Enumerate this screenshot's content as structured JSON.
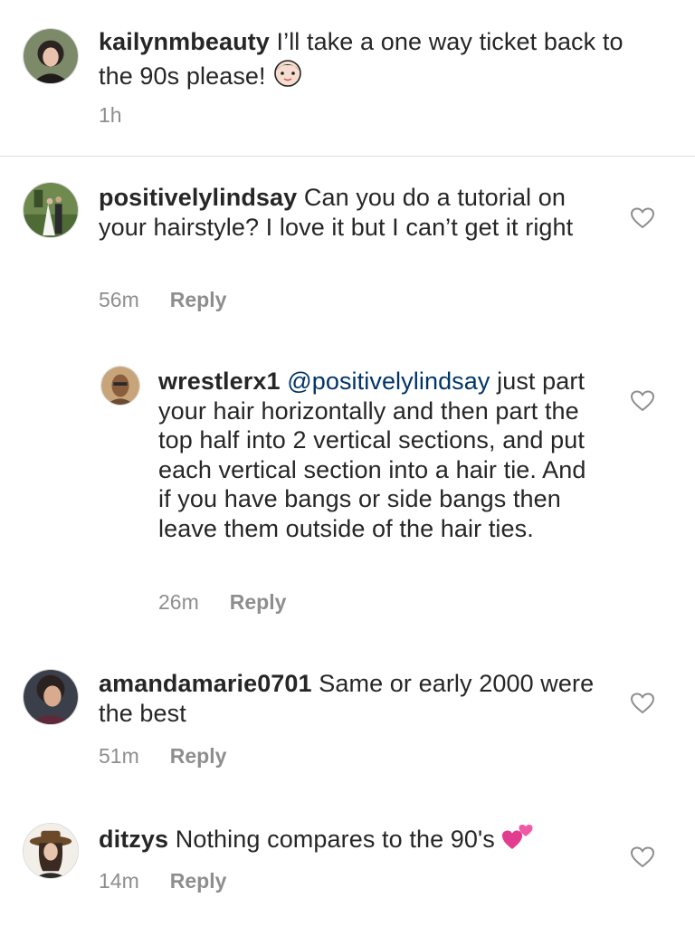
{
  "comments": [
    {
      "username": "kailynmbeauty",
      "text": " I’ll take a one way ticket back to the 90s please! ",
      "emoji": "girl-emoji",
      "time": "1h",
      "reply_label": ""
    },
    {
      "username": "positivelylindsay",
      "text": " Can you do a tutorial on your hairstyle? I love it but I can’t get it right",
      "time": "56m",
      "reply_label": "Reply"
    },
    {
      "username": "wrestlerx1",
      "mention": "@positivelylindsay",
      "text": " just part your hair horizontally and then part the top half into 2 vertical sections, and put each vertical section into a hair tie. And if you have bangs or side bangs then leave them outside of the hair ties.",
      "time": "26m",
      "reply_label": "Reply"
    },
    {
      "username": "amandamarie0701",
      "text": " Same or early 2000 were the best",
      "time": "51m",
      "reply_label": "Reply"
    },
    {
      "username": "ditzys",
      "text": " Nothing compares to the 90's ",
      "emoji": "two-hearts-emoji",
      "time": "14m",
      "reply_label": "Reply"
    }
  ],
  "icons": {
    "like": "heart-outline-icon"
  },
  "colors": {
    "mention": "#003569",
    "meta": "#8e8e8e",
    "text": "#262626"
  }
}
